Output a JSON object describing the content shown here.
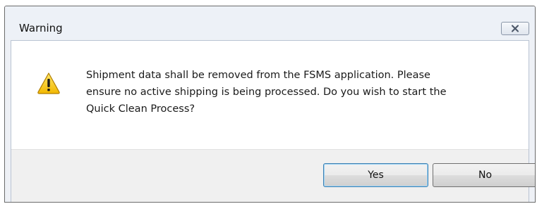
{
  "window": {
    "title": "Warning",
    "close_icon": "close-icon"
  },
  "dialog": {
    "icon": "warning-icon",
    "message": "Shipment data shall be removed from the FSMS application. Please ensure no active shipping is being processed. Do you wish to start the Quick Clean Process?",
    "message_lines": [
      "Shipment data shall be removed from the FSMS application. Please",
      "ensure no active shipping is being processed. Do you wish to start the",
      "Quick Clean Process?"
    ]
  },
  "buttons": {
    "yes_label": "Yes",
    "no_label": "No"
  },
  "colors": {
    "warning_fill": "#f5c800",
    "warning_outline": "#b07d00",
    "default_button_border": "#3c7fb1"
  }
}
